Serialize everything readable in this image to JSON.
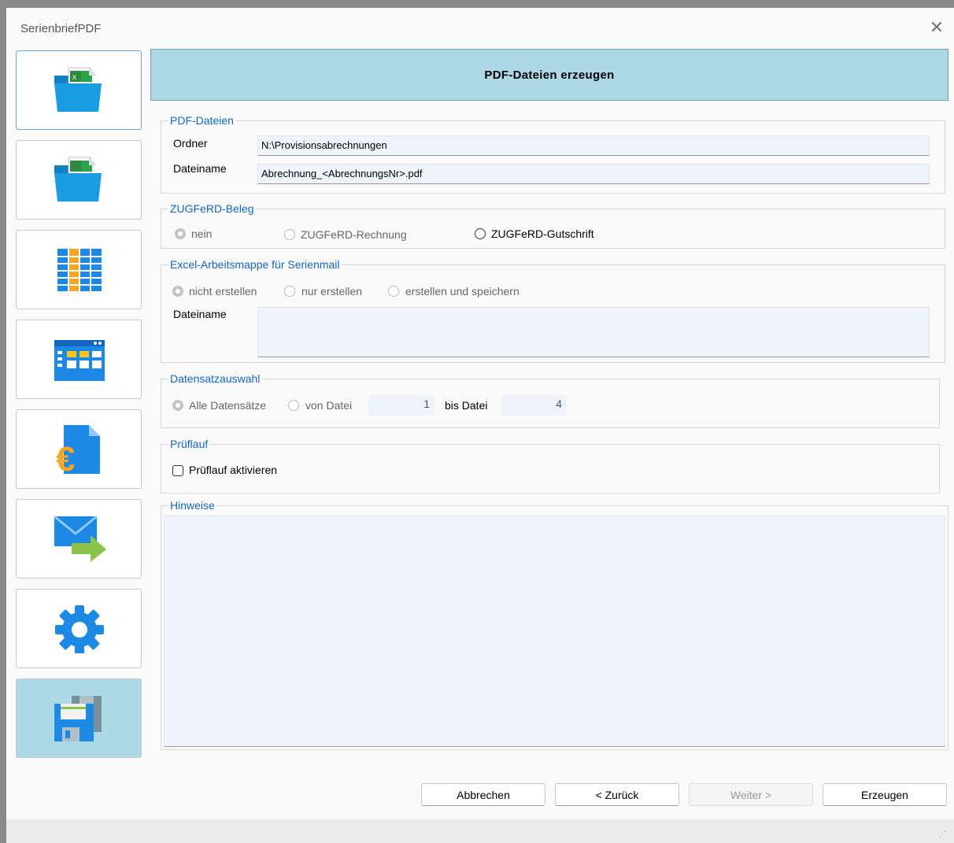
{
  "window": {
    "title": "SerienbriefPDF",
    "close_glyph": "✕"
  },
  "colors": {
    "header_bg": "#add8e6",
    "legend": "#1565c0",
    "field_bg": "#eef4fb",
    "accent_blue": "#1e88e5",
    "folder_blue": "#1a9ce0"
  },
  "sidebar": {
    "items": [
      {
        "icon": "excel-folder-icon",
        "state": "focused"
      },
      {
        "icon": "excel-folder-icon",
        "state": "normal"
      },
      {
        "icon": "spreadsheet-grid-icon",
        "state": "normal"
      },
      {
        "icon": "table-window-icon",
        "state": "normal"
      },
      {
        "icon": "euro-document-icon",
        "state": "normal"
      },
      {
        "icon": "mail-forward-icon",
        "state": "normal"
      },
      {
        "icon": "gear-icon",
        "state": "normal"
      },
      {
        "icon": "floppy-save-icon",
        "state": "active"
      }
    ]
  },
  "header": {
    "title": "PDF-Dateien erzeugen"
  },
  "pdf_files": {
    "legend": "PDF-Dateien",
    "folder_label": "Ordner",
    "folder_value": "N:\\Provisionsabrechnungen",
    "filename_label": "Dateiname",
    "filename_value": "Abrechnung_<AbrechnungsNr>.pdf"
  },
  "zugferd": {
    "legend": "ZUGFeRD-Beleg",
    "options": [
      "nein",
      "ZUGFeRD-Rechnung",
      "ZUGFeRD-Gutschrift"
    ],
    "selected": "nein"
  },
  "excel": {
    "legend": "Excel-Arbeitsmappe für Serienmail",
    "options": [
      "nicht erstellen",
      "nur erstellen",
      "erstellen und speichern"
    ],
    "selected": "nicht erstellen",
    "filename_label": "Dateiname",
    "filename_value": ""
  },
  "records": {
    "legend": "Datensatzauswahl",
    "all_label": "Alle Datensätze",
    "from_label": "von Datei",
    "from_value": "1",
    "to_label": "bis Datei",
    "to_value": "4",
    "selected": "Alle Datensätze"
  },
  "test_run": {
    "legend": "Prüflauf",
    "checkbox_label": "Prüflauf aktivieren",
    "checked": false
  },
  "notes": {
    "legend": "Hinweise",
    "text": ""
  },
  "buttons": {
    "cancel": "Abbrechen",
    "back": "< Zurück",
    "next": "Weiter >",
    "create": "Erzeugen"
  }
}
